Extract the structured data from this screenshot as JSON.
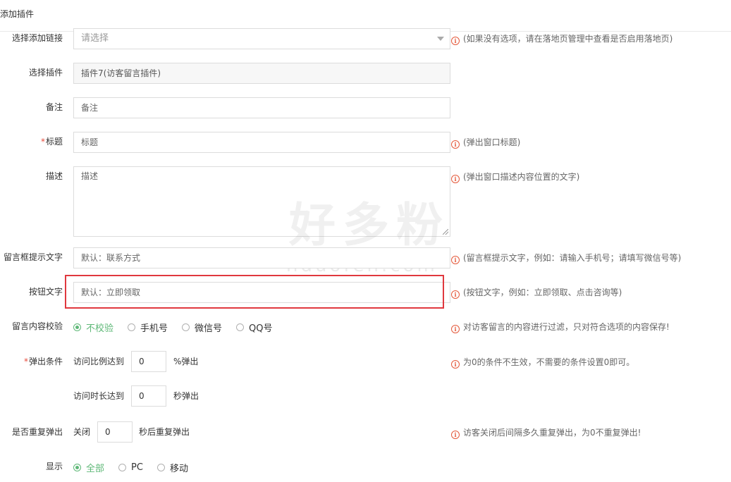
{
  "page": {
    "title": "添加插件"
  },
  "colors": {
    "accent": "#5fb878",
    "required": "#e74c3c",
    "info_icon": "#e4593b",
    "highlight": "#e0383e"
  },
  "form": {
    "link": {
      "label": "选择添加链接",
      "placeholder": "请选择",
      "hint": "(如果没有选项，请在落地页管理中查看是否启用落地页)"
    },
    "plugin": {
      "label": "选择插件",
      "value": "插件7(访客留言插件)"
    },
    "remark": {
      "label": "备注",
      "placeholder": "备注"
    },
    "title": {
      "required_mark": "*",
      "label": "标题",
      "placeholder": "标题",
      "hint": "(弹出窗口标题)"
    },
    "description": {
      "label": "描述",
      "placeholder": "描述",
      "hint": "(弹出窗口描述内容位置的文字)"
    },
    "message_prompt": {
      "label": "留言框提示文字",
      "placeholder": "默认：联系方式",
      "hint": "(留言框提示文字，例如：请输入手机号；请填写微信号等)"
    },
    "button_text": {
      "label": "按钮文字",
      "placeholder": "默认：立即领取",
      "hint": "(按钮文字，例如：立即领取、点击咨询等)"
    },
    "validation": {
      "label": "留言内容校验",
      "options": [
        "不校验",
        "手机号",
        "微信号",
        "QQ号"
      ],
      "selected": "不校验",
      "hint": "对访客留言的内容进行过滤，只对符合选项的内容保存!"
    },
    "popup_condition": {
      "required_mark": "*",
      "label": "弹出条件",
      "ratio_prefix": "访问比例达到",
      "ratio_value": "0",
      "ratio_suffix": "%弹出",
      "duration_prefix": "访问时长达到",
      "duration_value": "0",
      "duration_suffix": "秒弹出",
      "hint": "为0的条件不生效，不需要的条件设置0即可。"
    },
    "repeat_popup": {
      "label": "是否重复弹出",
      "prefix": "关闭",
      "value": "0",
      "suffix": "秒后重复弹出",
      "hint": "访客关闭后间隔多久重复弹出，为0不重复弹出!"
    },
    "display": {
      "label": "显示",
      "options": [
        "全部",
        "PC",
        "移动"
      ],
      "selected": "全部"
    }
  },
  "watermark": {
    "main": "好多粉",
    "sub": "hduofen.com"
  },
  "icons": {
    "info": "info-circle-icon",
    "dropdown": "chevron-down-icon"
  }
}
